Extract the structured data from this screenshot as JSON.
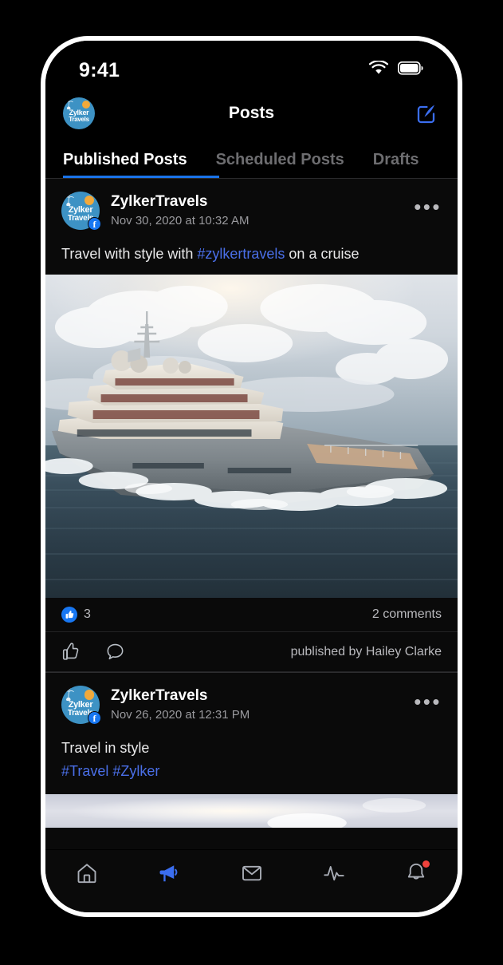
{
  "status_bar": {
    "time": "9:41",
    "wifi_icon": "wifi-icon",
    "battery_icon": "battery-full-icon"
  },
  "nav": {
    "title": "Posts",
    "brand_avatar": "zylker-travels-avatar",
    "brand_avatar_line1": "Zylker",
    "brand_avatar_line2": "Travels",
    "compose_icon": "compose-icon"
  },
  "tabs": {
    "items": [
      {
        "label": "Published Posts",
        "active": true
      },
      {
        "label": "Scheduled Posts",
        "active": false
      },
      {
        "label": "Drafts",
        "active": false
      }
    ],
    "active_underline_color": "#1a73e8"
  },
  "posts": [
    {
      "author": "ZylkerTravels",
      "timestamp": "Nov 30, 2020 at 10:32 AM",
      "network_badge": "facebook-badge",
      "more_icon": "more-options-icon",
      "text_before": "Travel with style with ",
      "hashtag": "#zylkertravels",
      "text_after": " on a cruise",
      "media": "cruise-ship-photo",
      "like_count": "3",
      "like_icon": "thumbs-up-filled-icon",
      "comments": "2 comments",
      "action_like_icon": "thumbs-up-outline-icon",
      "action_comment_icon": "comment-bubble-icon",
      "published_by": "published by Hailey Clarke"
    },
    {
      "author": "ZylkerTravels",
      "timestamp": "Nov 26, 2020 at 12:31 PM",
      "network_badge": "facebook-badge",
      "more_icon": "more-options-icon",
      "text": "Travel in style",
      "tags": "#Travel #Zylker",
      "media": "sky-clouds-photo"
    }
  ],
  "bottom_nav": {
    "items": [
      {
        "icon": "home-icon",
        "active": false
      },
      {
        "icon": "megaphone-icon",
        "active": true
      },
      {
        "icon": "mail-icon",
        "active": false
      },
      {
        "icon": "activity-pulse-icon",
        "active": false
      },
      {
        "icon": "bell-notification-icon",
        "active": false,
        "badge": true
      }
    ],
    "active_color": "#3b6ef0",
    "inactive_color": "#a9adb6",
    "badge_color": "#f0423c"
  },
  "colors": {
    "accent_blue": "#1a73e8",
    "link_blue": "#4a6fe8",
    "facebook_blue": "#1877f2",
    "screen_bg": "#0a0a0a"
  }
}
